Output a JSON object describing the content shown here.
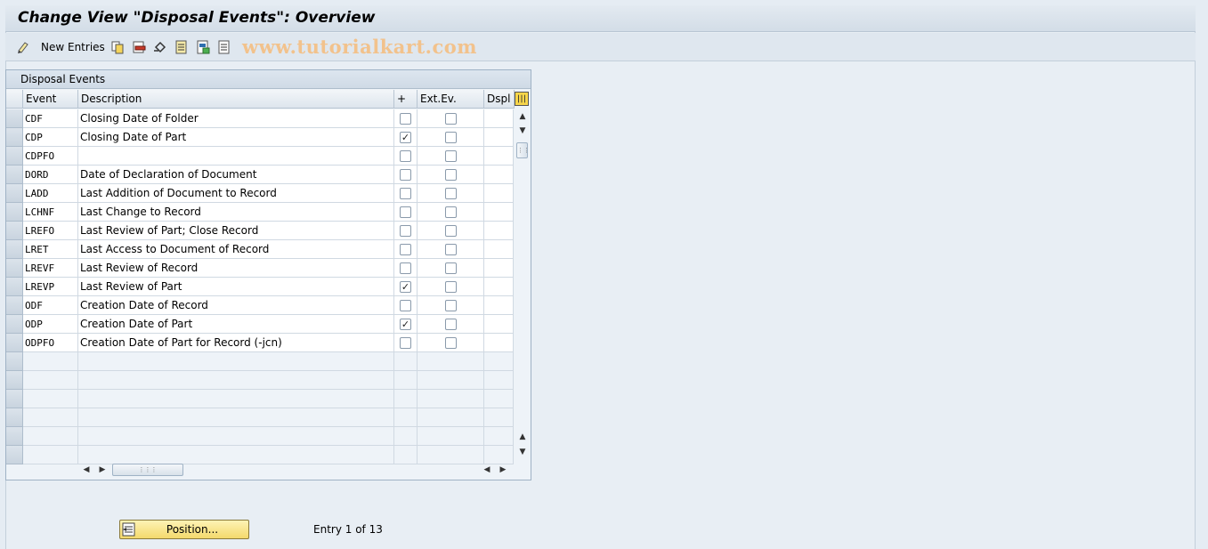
{
  "window": {
    "title": "Change View \"Disposal Events\": Overview"
  },
  "toolbar": {
    "new_entries_label": "New Entries",
    "watermark": "www.tutorialkart.com",
    "icons": [
      "edit-pencil-icon",
      "copy-icon",
      "delete-icon",
      "undo-icon",
      "select-all-icon",
      "select-block-icon",
      "deselect-all-icon"
    ]
  },
  "table": {
    "title": "Disposal Events",
    "columns": [
      "Event",
      "Description",
      "+",
      "Ext.Ev.",
      "Dspl D"
    ],
    "rows": [
      {
        "event": "CDF",
        "description": "Closing Date of Folder",
        "plus": false,
        "ext": false
      },
      {
        "event": "CDP",
        "description": "Closing Date of Part",
        "plus": true,
        "ext": false
      },
      {
        "event": "CDPFO",
        "description": "",
        "plus": false,
        "ext": false
      },
      {
        "event": "DORD",
        "description": "Date of Declaration of Document",
        "plus": false,
        "ext": false
      },
      {
        "event": "LADD",
        "description": "Last Addition of Document to Record",
        "plus": false,
        "ext": false
      },
      {
        "event": "LCHNF",
        "description": "Last Change to Record",
        "plus": false,
        "ext": false
      },
      {
        "event": "LREFO",
        "description": "Last Review of Part; Close Record",
        "plus": false,
        "ext": false
      },
      {
        "event": "LRET",
        "description": "Last Access to Document of Record",
        "plus": false,
        "ext": false
      },
      {
        "event": "LREVF",
        "description": "Last Review of Record",
        "plus": false,
        "ext": false
      },
      {
        "event": "LREVP",
        "description": "Last Review of Part",
        "plus": true,
        "ext": false
      },
      {
        "event": "ODF",
        "description": "Creation Date of Record",
        "plus": false,
        "ext": false
      },
      {
        "event": "ODP",
        "description": "Creation Date of Part",
        "plus": true,
        "ext": false
      },
      {
        "event": "ODPFO",
        "description": "Creation Date of Part for Record (-jcn)",
        "plus": false,
        "ext": false
      }
    ],
    "empty_rows": 6
  },
  "footer": {
    "position_button": "Position...",
    "entry_info": "Entry 1 of 13"
  }
}
